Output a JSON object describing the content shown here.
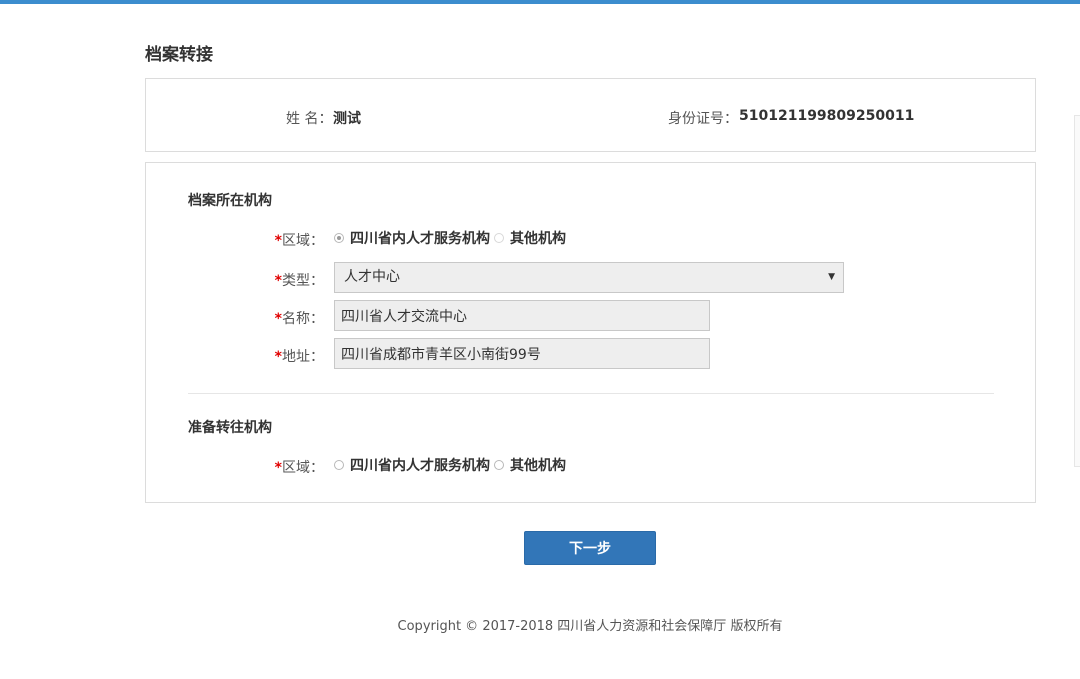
{
  "page": {
    "title": "档案转接"
  },
  "person": {
    "name_label": "姓 名：",
    "name_value": "测试",
    "id_label": "身份证号：",
    "id_value": "510121199809250011"
  },
  "current_org": {
    "section_title": "档案所在机构",
    "region_label": "区域：",
    "region_options": [
      "四川省内人才服务机构",
      "其他机构"
    ],
    "region_selected": "四川省内人才服务机构",
    "type_label": "类型：",
    "type_value": "人才中心",
    "name_label": "名称：",
    "name_value": "四川省人才交流中心",
    "address_label": "地址：",
    "address_value": "四川省成都市青羊区小南街99号"
  },
  "target_org": {
    "section_title": "准备转往机构",
    "region_label": "区域：",
    "region_options": [
      "四川省内人才服务机构",
      "其他机构"
    ]
  },
  "required_mark": "*",
  "next_button": "下一步",
  "footer": {
    "copyright": "Copyright © 2017-2018 四川省人力资源和社会保障厅 版权所有"
  },
  "colors": {
    "accent": "#3c8dce",
    "button": "#3276b8",
    "required": "#e00000"
  }
}
